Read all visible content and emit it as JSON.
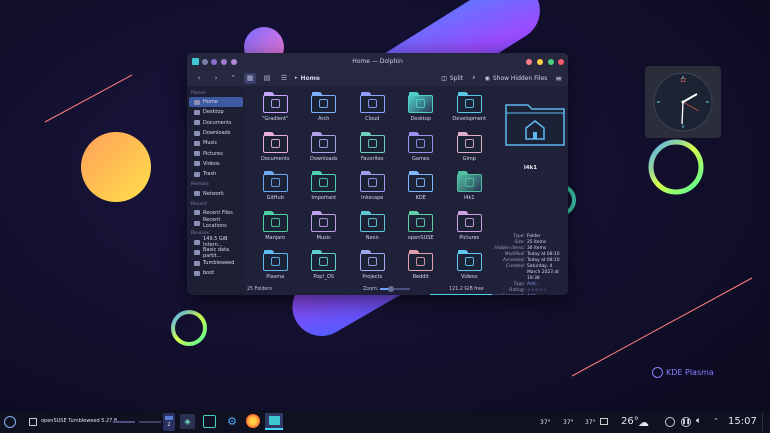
{
  "window": {
    "title": "Home — Dolphin",
    "breadcrumb": "Home",
    "split_label": "Split",
    "hidden_files_label": "Show Hidden Files"
  },
  "sidebar": {
    "sections": [
      {
        "header": "Places",
        "items": [
          {
            "label": "Home",
            "icon": "home-icon",
            "selected": true
          },
          {
            "label": "Desktop",
            "icon": "desktop-icon"
          },
          {
            "label": "Documents",
            "icon": "documents-icon"
          },
          {
            "label": "Downloads",
            "icon": "downloads-icon"
          },
          {
            "label": "Music",
            "icon": "music-icon"
          },
          {
            "label": "Pictures",
            "icon": "pictures-icon"
          },
          {
            "label": "Videos",
            "icon": "videos-icon"
          },
          {
            "label": "Trash",
            "icon": "trash-icon"
          }
        ]
      },
      {
        "header": "Remote",
        "items": [
          {
            "label": "Network",
            "icon": "network-icon"
          }
        ]
      },
      {
        "header": "Recent",
        "items": [
          {
            "label": "Recent Files",
            "icon": "recent-files-icon"
          },
          {
            "label": "Recent Locations",
            "icon": "recent-locations-icon"
          }
        ]
      },
      {
        "header": "Devices",
        "items": [
          {
            "label": "149.5 GiB Intern...",
            "icon": "drive-icon"
          },
          {
            "label": "Basic data partit...",
            "icon": "drive-icon"
          },
          {
            "label": "Tumbleweed",
            "icon": "drive-icon"
          },
          {
            "label": "boot",
            "icon": "drive-icon"
          }
        ]
      }
    ]
  },
  "folders": [
    {
      "label": "\"Gradient\"",
      "color": "#c9a7ff"
    },
    {
      "label": "Arch",
      "color": "#7fb1ff"
    },
    {
      "label": "Cloud",
      "color": "#8fa0ff"
    },
    {
      "label": "Desktop",
      "color": "#4fd0c7",
      "preview": true
    },
    {
      "label": "Development",
      "color": "#5ac8e8"
    },
    {
      "label": "Documents",
      "color": "#e8b0d8"
    },
    {
      "label": "Downloads",
      "color": "#b0a0e8"
    },
    {
      "label": "Favorites",
      "color": "#6fd0c0"
    },
    {
      "label": "Games",
      "color": "#9f8ff0"
    },
    {
      "label": "Gimp",
      "color": "#e0b0c8"
    },
    {
      "label": "GitHub",
      "color": "#6fa8f0"
    },
    {
      "label": "Important",
      "color": "#4fd0b0"
    },
    {
      "label": "Inkscape",
      "color": "#9f9ff0"
    },
    {
      "label": "KDE",
      "color": "#7fb8ff"
    },
    {
      "label": "l4k1",
      "color": "#4fc0a0",
      "preview": true
    },
    {
      "label": "Manjaro",
      "color": "#4fd0a0"
    },
    {
      "label": "Music",
      "color": "#c0a0e8"
    },
    {
      "label": "Neon",
      "color": "#5fc8d8"
    },
    {
      "label": "openSUSE",
      "color": "#5fd0a8"
    },
    {
      "label": "Pictures",
      "color": "#d0a0e0"
    },
    {
      "label": "Plasma",
      "color": "#5fb8f0"
    },
    {
      "label": "Pop!_OS",
      "color": "#5fd0d0"
    },
    {
      "label": "Projects",
      "color": "#a0a8f0"
    },
    {
      "label": "Reddit",
      "color": "#e0a0b0"
    },
    {
      "label": "Videos",
      "color": "#5fc8f0"
    }
  ],
  "status": {
    "folders": "25 Folders",
    "zoom_label": "Zoom:",
    "free_space": "121.2 GiB free",
    "zoom_level": 0.35,
    "free_fraction": 0.85
  },
  "info_panel": {
    "name": "l4k1",
    "rows": [
      {
        "k": "Type:",
        "v": "Folder"
      },
      {
        "k": "Size:",
        "v": "25 items"
      },
      {
        "k": "Hidden items:",
        "v": "30 items"
      },
      {
        "k": "Modified:",
        "v": "Today at 08:10"
      },
      {
        "k": "Accessed:",
        "v": "Today at 08:10"
      },
      {
        "k": "Created:",
        "v": "Saturday, 4"
      },
      {
        "k": "",
        "v": "March 2023 at"
      },
      {
        "k": "",
        "v": "19:38"
      },
      {
        "k": "Tags:",
        "v": "Add..."
      },
      {
        "k": "Rating:",
        "v": "☆☆☆☆☆"
      },
      {
        "k": "Comment:",
        "v": "Add..."
      }
    ]
  },
  "desktop": {
    "watermark": "KDE Plasma"
  },
  "taskbar": {
    "window_title": "openSUSE Tumbleweed 5.27.8",
    "pager_number": "2",
    "temps": [
      "37°",
      "37°",
      "37°"
    ],
    "weather_temp": "26°",
    "time": "15:07"
  }
}
